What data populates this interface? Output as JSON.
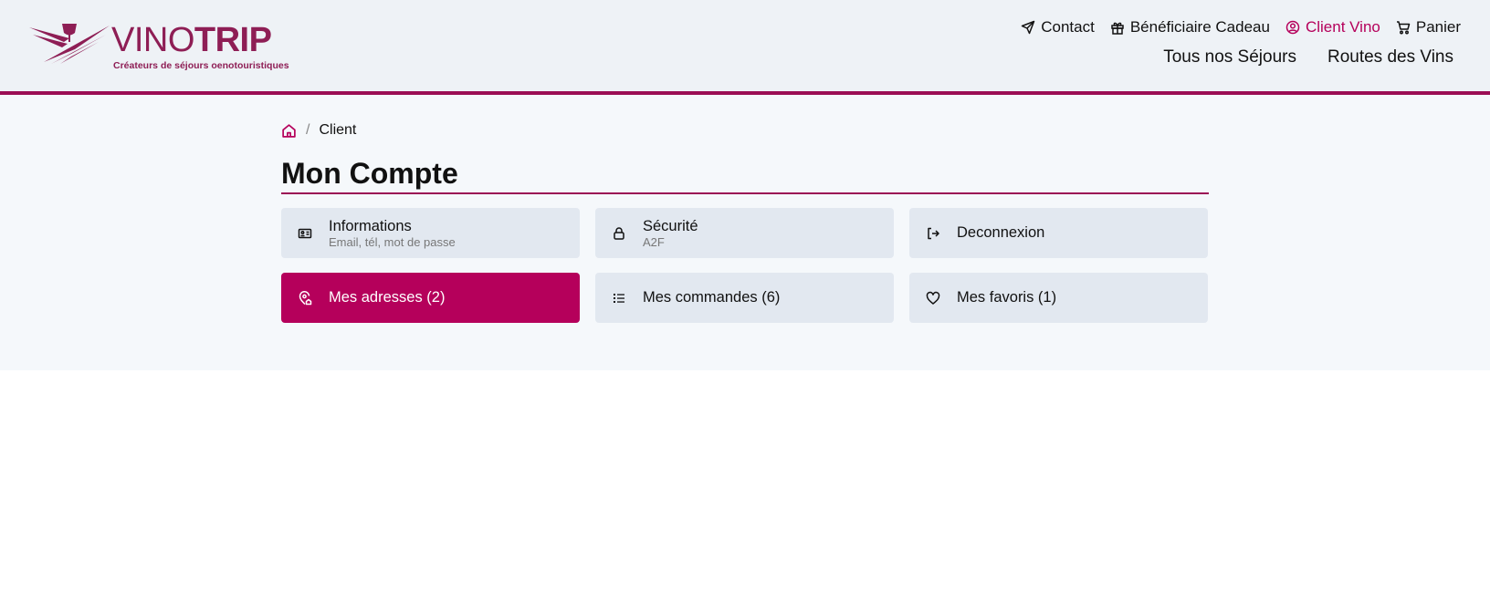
{
  "brand": {
    "word_thin": "VINO",
    "word_bold": "TRIP",
    "tagline": "Créateurs de séjours oenotouristiques",
    "color": "#8e1e55"
  },
  "accent_color": "#b5005b",
  "top_nav": [
    {
      "label": "Contact",
      "icon": "send-icon"
    },
    {
      "label": "Bénéficiaire Cadeau",
      "icon": "gift-icon"
    },
    {
      "label": "Client Vino",
      "icon": "user-circle-icon",
      "active": true
    },
    {
      "label": "Panier",
      "icon": "cart-icon"
    }
  ],
  "main_nav": [
    {
      "label": "Tous nos Séjours"
    },
    {
      "label": "Routes des Vins"
    }
  ],
  "breadcrumb": {
    "home_icon": "home-icon",
    "current": "Client"
  },
  "page_title": "Mon Compte",
  "tiles": [
    {
      "label": "Informations",
      "sub": "Email, tél, mot de passe",
      "icon": "id-card-icon"
    },
    {
      "label": "Sécurité",
      "sub": "A2F",
      "icon": "lock-icon"
    },
    {
      "label": "Deconnexion",
      "icon": "logout-icon"
    },
    {
      "label": "Mes adresses (2)",
      "icon": "map-pin-home-icon",
      "active": true
    },
    {
      "label": "Mes commandes (6)",
      "icon": "list-icon"
    },
    {
      "label": "Mes favoris (1)",
      "icon": "heart-icon"
    }
  ]
}
